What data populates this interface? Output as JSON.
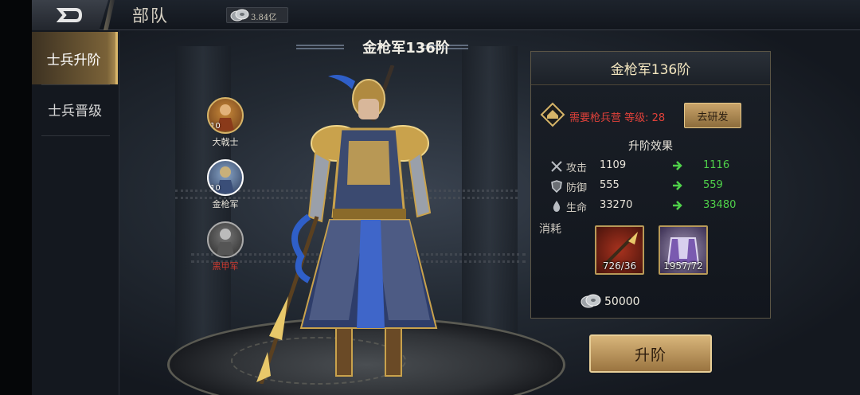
{
  "header": {
    "title": "部队",
    "currency_value": "3.84亿"
  },
  "sidebar": {
    "items": [
      {
        "label": "士兵升阶",
        "active": true
      },
      {
        "label": "士兵晋级",
        "active": false
      }
    ]
  },
  "character": {
    "title": "金枪军136阶"
  },
  "units": [
    {
      "name": "大戟士",
      "level": "10"
    },
    {
      "name": "金枪军",
      "level": "10"
    },
    {
      "name": "黑甲军",
      "level": ""
    }
  ],
  "panel": {
    "title": "金枪军136阶",
    "requirement": "需要枪兵营 等级: 28",
    "research_button": "去研发",
    "effect_title": "升阶效果",
    "stats": [
      {
        "label": "攻击",
        "current": "1109",
        "next": "1116",
        "icon": "sword-icon"
      },
      {
        "label": "防御",
        "current": "555",
        "next": "559",
        "icon": "shield-icon"
      },
      {
        "label": "生命",
        "current": "33270",
        "next": "33480",
        "icon": "drop-icon"
      }
    ],
    "consume_label": "消耗",
    "items": [
      {
        "count": "726/36",
        "icon": "spear-icon"
      },
      {
        "count": "1957/72",
        "icon": "armor-icon"
      }
    ],
    "cost": "50000"
  },
  "upgrade_button": "升阶",
  "colors": {
    "accent_gold": "#d6b468",
    "requirement_red": "#e0413a",
    "stat_green": "#4fd04a"
  }
}
